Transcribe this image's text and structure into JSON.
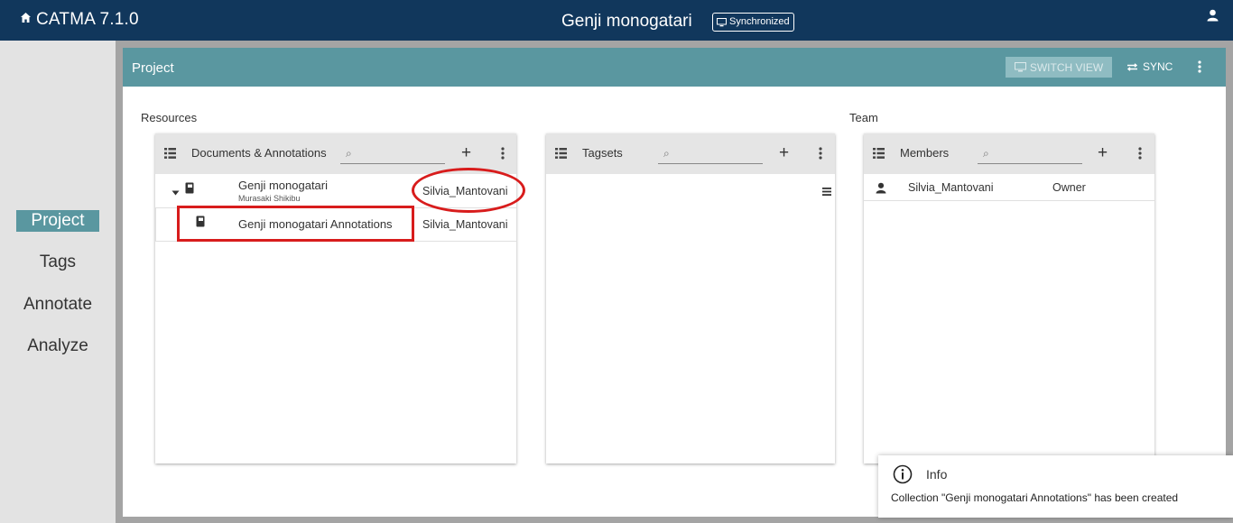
{
  "topbar": {
    "app_title": "CATMA 7.1.0",
    "project_title": "Genji monogatari",
    "sync_status": "Synchronized",
    "home_icon": "home-icon",
    "user_icon": "user-icon"
  },
  "nav": {
    "items": [
      {
        "label": "Project",
        "active": true
      },
      {
        "label": "Tags",
        "active": false
      },
      {
        "label": "Annotate",
        "active": false
      },
      {
        "label": "Analyze",
        "active": false
      }
    ]
  },
  "project_header": {
    "title": "Project",
    "switch_view": "SWITCH VIEW",
    "sync": "SYNC"
  },
  "sections": {
    "resources": "Resources",
    "team": "Team"
  },
  "documents_card": {
    "title": "Documents & Annotations",
    "search_placeholder": "",
    "rows": [
      {
        "title": "Genji monogatari",
        "subtitle": "Murasaki Shikibu",
        "owner": "Silvia_Mantovani",
        "type": "document",
        "expanded": true
      },
      {
        "title": "Genji monogatari Annotations",
        "subtitle": "",
        "owner": "Silvia_Mantovani",
        "type": "collection"
      }
    ]
  },
  "tagsets_card": {
    "title": "Tagsets",
    "search_placeholder": ""
  },
  "members_card": {
    "title": "Members",
    "search_placeholder": "",
    "rows": [
      {
        "name": "Silvia_Mantovani",
        "role": "Owner"
      }
    ]
  },
  "toast": {
    "title": "Info",
    "message": "Collection \"Genji monogatari Annotations\" has been created"
  },
  "colors": {
    "topbar": "#11375c",
    "accent": "#5a97a0",
    "highlight": "#d81c1c"
  }
}
